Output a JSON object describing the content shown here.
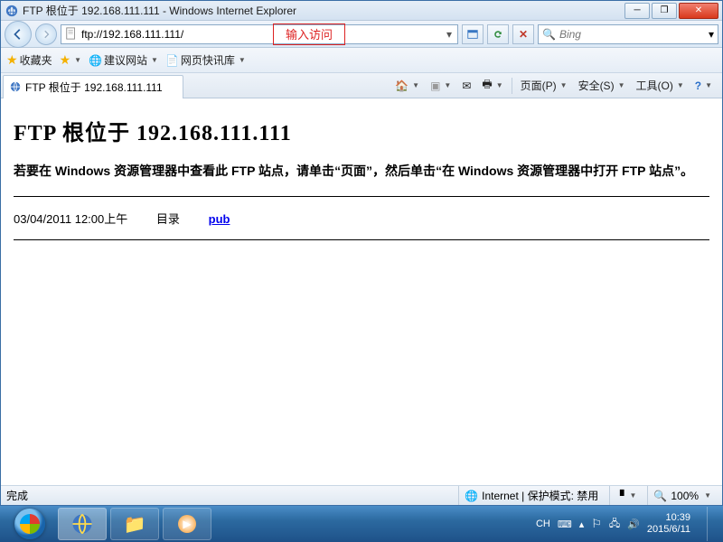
{
  "window": {
    "title": "FTP 根位于 192.168.111.111 - Windows Internet Explorer"
  },
  "nav": {
    "url": "ftp://192.168.111.111/",
    "annotation": "输入访问",
    "search_placeholder": "Bing"
  },
  "favbar": {
    "favorites": "收藏夹",
    "suggested": "建议网站",
    "gallery": "网页快讯库"
  },
  "tab": {
    "title": "FTP 根位于 192.168.111.111"
  },
  "cmd": {
    "page": "页面(P)",
    "safety": "安全(S)",
    "tools": "工具(O)"
  },
  "page": {
    "heading": "FTP 根位于 192.168.111.111",
    "msg_a": "若要在 Windows 资源管理器中查看此 FTP 站点，请单击",
    "msg_b": "“页面”",
    "msg_c": "，然后单击",
    "msg_d": "“在 Windows 资源管理器中打开 FTP 站点”",
    "msg_e": "。",
    "entry": {
      "datetime": "03/04/2011 12:00上午",
      "type": "目录",
      "name": "pub"
    }
  },
  "status": {
    "done": "完成",
    "zone": "Internet | 保护模式: 禁用",
    "zoom": "100%"
  },
  "tray": {
    "ime": "CH",
    "time": "10:39",
    "date": "2015/6/11"
  }
}
